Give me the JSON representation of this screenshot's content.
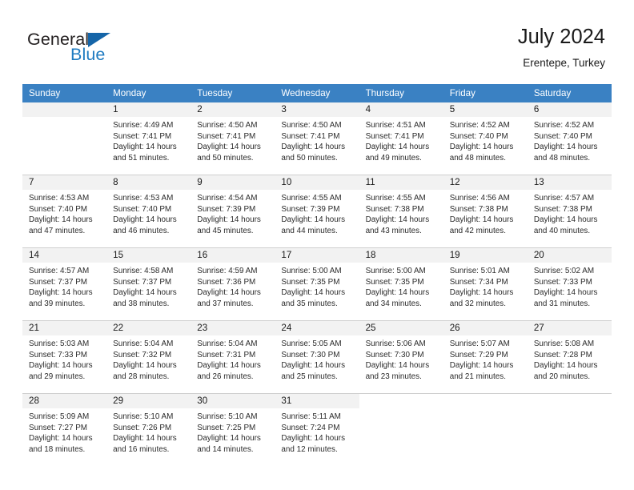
{
  "brand": {
    "name_part1": "General",
    "name_part2": "Blue",
    "triangle_icon": "triangle-icon",
    "color_primary": "#1f7bc1",
    "color_dark": "#1565a8"
  },
  "header": {
    "title": "July 2024",
    "subtitle": "Erentepe, Turkey"
  },
  "calendar": {
    "header_bg": "#3a81c3",
    "daynum_bg": "#f2f2f2",
    "weekdays": [
      "Sunday",
      "Monday",
      "Tuesday",
      "Wednesday",
      "Thursday",
      "Friday",
      "Saturday"
    ],
    "weeks": [
      [
        {
          "day": "",
          "sunrise": "",
          "sunset": "",
          "daylight1": "",
          "daylight2": "",
          "blank": true
        },
        {
          "day": "1",
          "sunrise": "Sunrise: 4:49 AM",
          "sunset": "Sunset: 7:41 PM",
          "daylight1": "Daylight: 14 hours",
          "daylight2": "and 51 minutes."
        },
        {
          "day": "2",
          "sunrise": "Sunrise: 4:50 AM",
          "sunset": "Sunset: 7:41 PM",
          "daylight1": "Daylight: 14 hours",
          "daylight2": "and 50 minutes."
        },
        {
          "day": "3",
          "sunrise": "Sunrise: 4:50 AM",
          "sunset": "Sunset: 7:41 PM",
          "daylight1": "Daylight: 14 hours",
          "daylight2": "and 50 minutes."
        },
        {
          "day": "4",
          "sunrise": "Sunrise: 4:51 AM",
          "sunset": "Sunset: 7:41 PM",
          "daylight1": "Daylight: 14 hours",
          "daylight2": "and 49 minutes."
        },
        {
          "day": "5",
          "sunrise": "Sunrise: 4:52 AM",
          "sunset": "Sunset: 7:40 PM",
          "daylight1": "Daylight: 14 hours",
          "daylight2": "and 48 minutes."
        },
        {
          "day": "6",
          "sunrise": "Sunrise: 4:52 AM",
          "sunset": "Sunset: 7:40 PM",
          "daylight1": "Daylight: 14 hours",
          "daylight2": "and 48 minutes."
        }
      ],
      [
        {
          "day": "7",
          "sunrise": "Sunrise: 4:53 AM",
          "sunset": "Sunset: 7:40 PM",
          "daylight1": "Daylight: 14 hours",
          "daylight2": "and 47 minutes."
        },
        {
          "day": "8",
          "sunrise": "Sunrise: 4:53 AM",
          "sunset": "Sunset: 7:40 PM",
          "daylight1": "Daylight: 14 hours",
          "daylight2": "and 46 minutes."
        },
        {
          "day": "9",
          "sunrise": "Sunrise: 4:54 AM",
          "sunset": "Sunset: 7:39 PM",
          "daylight1": "Daylight: 14 hours",
          "daylight2": "and 45 minutes."
        },
        {
          "day": "10",
          "sunrise": "Sunrise: 4:55 AM",
          "sunset": "Sunset: 7:39 PM",
          "daylight1": "Daylight: 14 hours",
          "daylight2": "and 44 minutes."
        },
        {
          "day": "11",
          "sunrise": "Sunrise: 4:55 AM",
          "sunset": "Sunset: 7:38 PM",
          "daylight1": "Daylight: 14 hours",
          "daylight2": "and 43 minutes."
        },
        {
          "day": "12",
          "sunrise": "Sunrise: 4:56 AM",
          "sunset": "Sunset: 7:38 PM",
          "daylight1": "Daylight: 14 hours",
          "daylight2": "and 42 minutes."
        },
        {
          "day": "13",
          "sunrise": "Sunrise: 4:57 AM",
          "sunset": "Sunset: 7:38 PM",
          "daylight1": "Daylight: 14 hours",
          "daylight2": "and 40 minutes."
        }
      ],
      [
        {
          "day": "14",
          "sunrise": "Sunrise: 4:57 AM",
          "sunset": "Sunset: 7:37 PM",
          "daylight1": "Daylight: 14 hours",
          "daylight2": "and 39 minutes."
        },
        {
          "day": "15",
          "sunrise": "Sunrise: 4:58 AM",
          "sunset": "Sunset: 7:37 PM",
          "daylight1": "Daylight: 14 hours",
          "daylight2": "and 38 minutes."
        },
        {
          "day": "16",
          "sunrise": "Sunrise: 4:59 AM",
          "sunset": "Sunset: 7:36 PM",
          "daylight1": "Daylight: 14 hours",
          "daylight2": "and 37 minutes."
        },
        {
          "day": "17",
          "sunrise": "Sunrise: 5:00 AM",
          "sunset": "Sunset: 7:35 PM",
          "daylight1": "Daylight: 14 hours",
          "daylight2": "and 35 minutes."
        },
        {
          "day": "18",
          "sunrise": "Sunrise: 5:00 AM",
          "sunset": "Sunset: 7:35 PM",
          "daylight1": "Daylight: 14 hours",
          "daylight2": "and 34 minutes."
        },
        {
          "day": "19",
          "sunrise": "Sunrise: 5:01 AM",
          "sunset": "Sunset: 7:34 PM",
          "daylight1": "Daylight: 14 hours",
          "daylight2": "and 32 minutes."
        },
        {
          "day": "20",
          "sunrise": "Sunrise: 5:02 AM",
          "sunset": "Sunset: 7:33 PM",
          "daylight1": "Daylight: 14 hours",
          "daylight2": "and 31 minutes."
        }
      ],
      [
        {
          "day": "21",
          "sunrise": "Sunrise: 5:03 AM",
          "sunset": "Sunset: 7:33 PM",
          "daylight1": "Daylight: 14 hours",
          "daylight2": "and 29 minutes."
        },
        {
          "day": "22",
          "sunrise": "Sunrise: 5:04 AM",
          "sunset": "Sunset: 7:32 PM",
          "daylight1": "Daylight: 14 hours",
          "daylight2": "and 28 minutes."
        },
        {
          "day": "23",
          "sunrise": "Sunrise: 5:04 AM",
          "sunset": "Sunset: 7:31 PM",
          "daylight1": "Daylight: 14 hours",
          "daylight2": "and 26 minutes."
        },
        {
          "day": "24",
          "sunrise": "Sunrise: 5:05 AM",
          "sunset": "Sunset: 7:30 PM",
          "daylight1": "Daylight: 14 hours",
          "daylight2": "and 25 minutes."
        },
        {
          "day": "25",
          "sunrise": "Sunrise: 5:06 AM",
          "sunset": "Sunset: 7:30 PM",
          "daylight1": "Daylight: 14 hours",
          "daylight2": "and 23 minutes."
        },
        {
          "day": "26",
          "sunrise": "Sunrise: 5:07 AM",
          "sunset": "Sunset: 7:29 PM",
          "daylight1": "Daylight: 14 hours",
          "daylight2": "and 21 minutes."
        },
        {
          "day": "27",
          "sunrise": "Sunrise: 5:08 AM",
          "sunset": "Sunset: 7:28 PM",
          "daylight1": "Daylight: 14 hours",
          "daylight2": "and 20 minutes."
        }
      ],
      [
        {
          "day": "28",
          "sunrise": "Sunrise: 5:09 AM",
          "sunset": "Sunset: 7:27 PM",
          "daylight1": "Daylight: 14 hours",
          "daylight2": "and 18 minutes."
        },
        {
          "day": "29",
          "sunrise": "Sunrise: 5:10 AM",
          "sunset": "Sunset: 7:26 PM",
          "daylight1": "Daylight: 14 hours",
          "daylight2": "and 16 minutes."
        },
        {
          "day": "30",
          "sunrise": "Sunrise: 5:10 AM",
          "sunset": "Sunset: 7:25 PM",
          "daylight1": "Daylight: 14 hours",
          "daylight2": "and 14 minutes."
        },
        {
          "day": "31",
          "sunrise": "Sunrise: 5:11 AM",
          "sunset": "Sunset: 7:24 PM",
          "daylight1": "Daylight: 14 hours",
          "daylight2": "and 12 minutes."
        },
        {
          "day": "",
          "sunrise": "",
          "sunset": "",
          "daylight1": "",
          "daylight2": "",
          "blank": true,
          "nofill": true
        },
        {
          "day": "",
          "sunrise": "",
          "sunset": "",
          "daylight1": "",
          "daylight2": "",
          "blank": true,
          "nofill": true
        },
        {
          "day": "",
          "sunrise": "",
          "sunset": "",
          "daylight1": "",
          "daylight2": "",
          "blank": true,
          "nofill": true
        }
      ]
    ]
  }
}
